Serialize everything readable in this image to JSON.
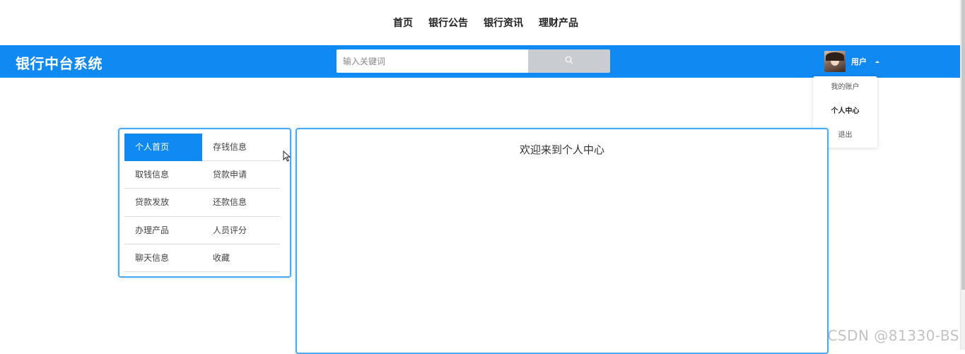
{
  "top_nav": {
    "items": [
      "首页",
      "银行公告",
      "银行资讯",
      "理财产品"
    ]
  },
  "header": {
    "brand": "银行中台系统",
    "search_placeholder": "输入关键词",
    "search_icon": "search-icon",
    "user_label": "用户",
    "background_color": "#1189f3"
  },
  "user_dropdown": {
    "items": [
      "我的账户",
      "个人中心",
      "退出"
    ],
    "active_item": "个人中心"
  },
  "side_menu": {
    "active": "个人首页",
    "items": [
      "个人首页",
      "存钱信息",
      "取钱信息",
      "贷款申请",
      "贷款发放",
      "还款信息",
      "办理产品",
      "人员评分",
      "聊天信息",
      "收藏"
    ]
  },
  "content": {
    "welcome": "欢迎来到个人中心"
  },
  "watermark": "CSDN @81330-BS"
}
